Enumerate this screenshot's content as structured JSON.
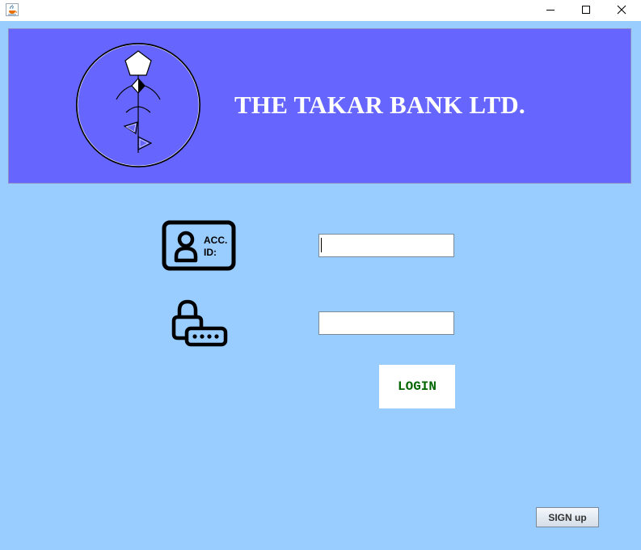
{
  "window": {
    "icon": "java-cup-icon",
    "controls": [
      "minimize-icon",
      "maximize-icon",
      "close-icon"
    ]
  },
  "header": {
    "bank_name": "THE TAKAR BANK LTD.",
    "background_color": "#6666ff",
    "logo": "bank-logo"
  },
  "form": {
    "account_icon": "account-id-card-icon",
    "account_icon_text_line1": "ACC.",
    "account_icon_text_line2": "ID:",
    "account_value": "",
    "password_icon": "padlock-password-icon",
    "password_value": ""
  },
  "buttons": {
    "login_label": "LOGIN",
    "login_color": "#006600",
    "signup_label": "SIGN up"
  },
  "colors": {
    "background": "#99ccff"
  }
}
